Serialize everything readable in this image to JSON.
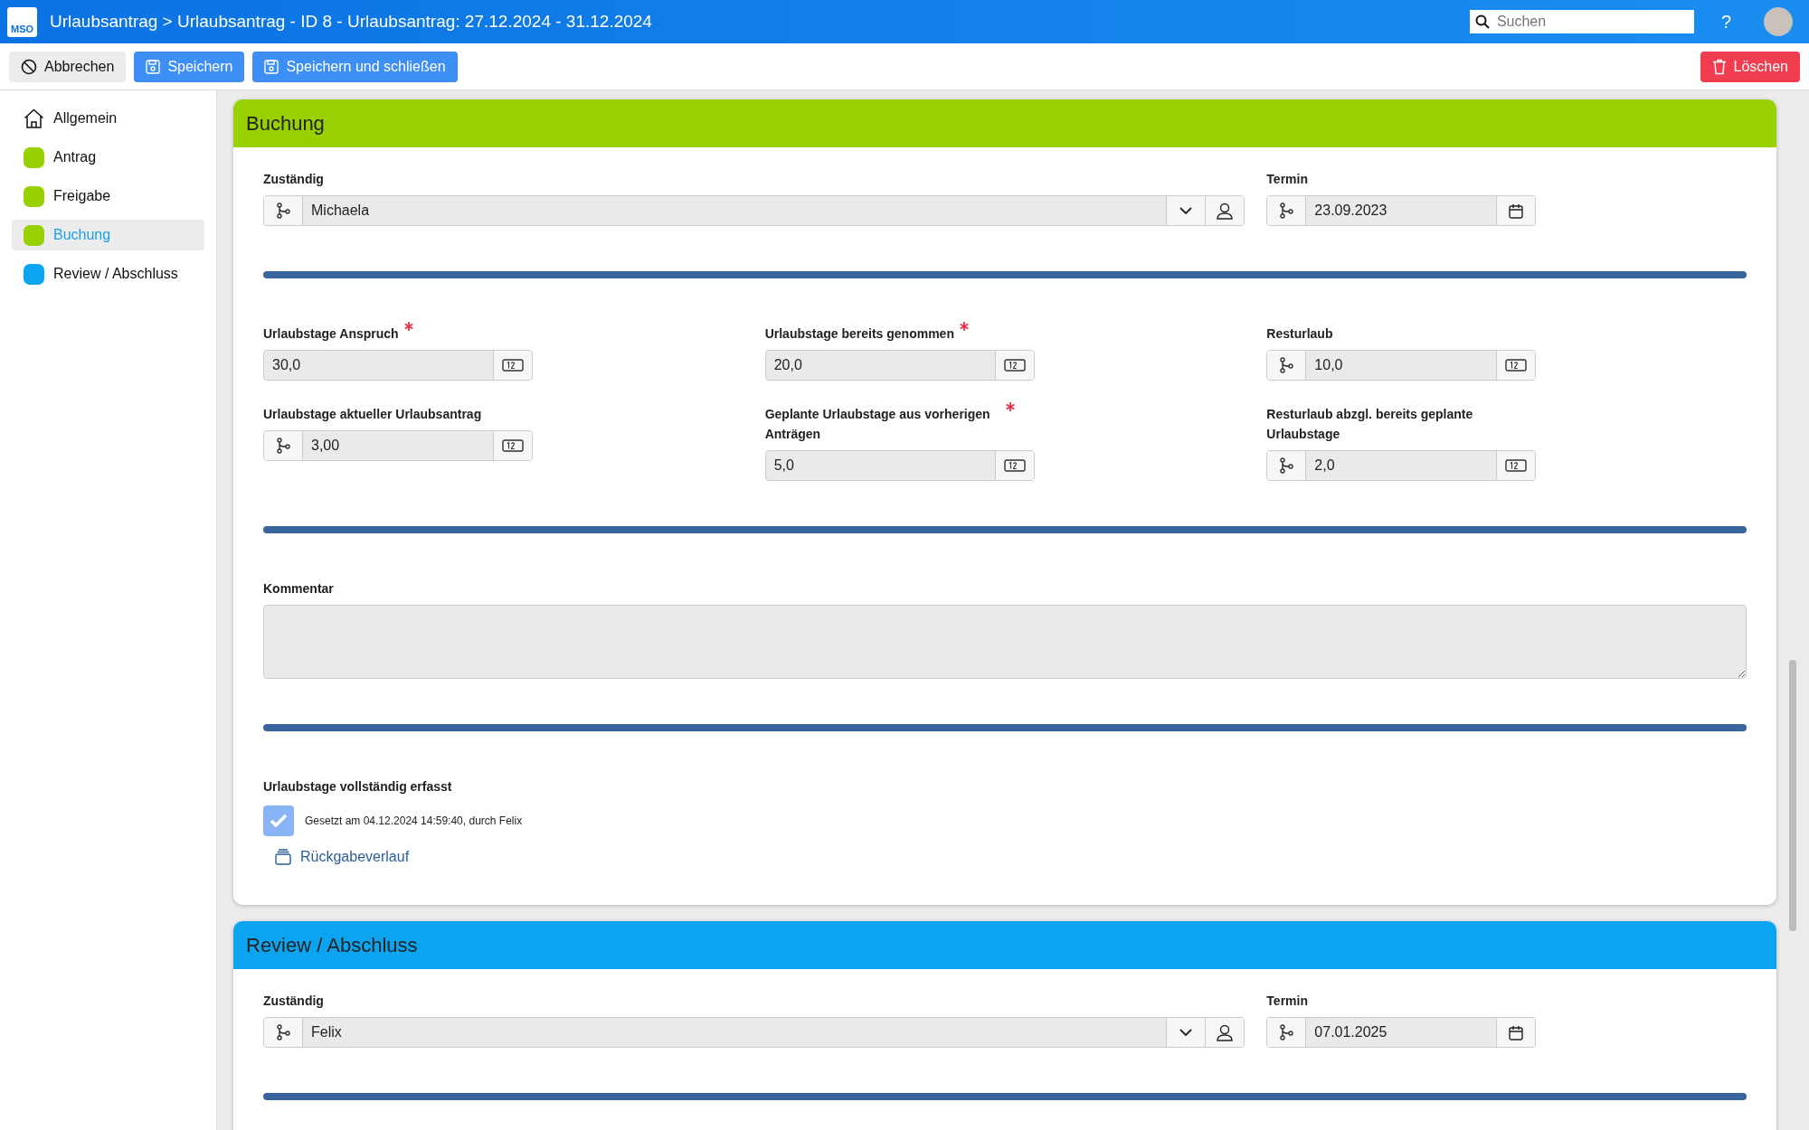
{
  "header": {
    "logo": "MSO",
    "title": "Urlaubsantrag > Urlaubsantrag - ID 8 - Urlaubsantrag: 27.12.2024 - 31.12.2024",
    "search": {
      "placeholder": "Suchen"
    },
    "help": "?"
  },
  "toolbar": {
    "buttons": [
      {
        "label": "Abbrechen",
        "kind": "cancel"
      },
      {
        "label": "Speichern",
        "kind": "save"
      },
      {
        "label": "Speichern und schließen",
        "kind": "save"
      },
      {
        "label": "Löschen",
        "kind": "delete"
      }
    ]
  },
  "sidebar": {
    "items": [
      {
        "label": "Allgemein",
        "kind": "home",
        "selected": false
      },
      {
        "label": "Antrag",
        "kind": "dot",
        "color": "#99d100",
        "selected": false
      },
      {
        "label": "Freigabe",
        "kind": "dot",
        "color": "#99d100",
        "selected": false
      },
      {
        "label": "Buchung",
        "kind": "dot",
        "color": "#99d100",
        "selected": true
      },
      {
        "label": "Review / Abschluss",
        "kind": "dot",
        "color": "#0aa4f0",
        "selected": false
      }
    ]
  },
  "sections": [
    {
      "title": "Buchung",
      "color": "#99d100",
      "blocks": [
        {
          "kind": "assignment",
          "assignee": {
            "label": "Zuständig",
            "value": "Michaela"
          },
          "date": {
            "label": "Termin",
            "value": "23.09.2023"
          }
        },
        {
          "kind": "divider"
        },
        {
          "kind": "numbers",
          "fields": [
            {
              "label": "Urlaubstage Anspruch",
              "required": true,
              "workflow": false,
              "value": "30,0"
            },
            {
              "label": "Urlaubstage bereits genommen",
              "required": true,
              "workflow": false,
              "value": "20,0"
            },
            {
              "label": "Resturlaub",
              "required": false,
              "workflow": true,
              "value": "10,0"
            },
            {
              "label": "Urlaubstage aktueller Urlaubsantrag",
              "required": false,
              "workflow": true,
              "value": "3,00"
            },
            {
              "label": "Geplante Urlaubstage aus vorherigen Anträgen",
              "required": true,
              "workflow": false,
              "value": "5,0"
            },
            {
              "label": "Resturlaub abzgl. bereits geplante Urlaubstage",
              "required": false,
              "workflow": true,
              "value": "2,0"
            }
          ]
        },
        {
          "kind": "divider"
        },
        {
          "kind": "comment",
          "label": "Kommentar"
        },
        {
          "kind": "divider"
        },
        {
          "kind": "checkbox",
          "label": "Urlaubstage vollständig erfasst",
          "checked": true,
          "note": "Gesetzt am 04.12.2024 14:59:40, durch Felix",
          "link": "Rückgabeverlauf"
        }
      ]
    },
    {
      "title": "Review / Abschluss",
      "color": "#0aa4f0",
      "blocks": [
        {
          "kind": "assignment",
          "assignee": {
            "label": "Zuständig",
            "value": "Felix"
          },
          "date": {
            "label": "Termin",
            "value": "07.01.2025"
          }
        },
        {
          "kind": "divider"
        }
      ]
    }
  ]
}
